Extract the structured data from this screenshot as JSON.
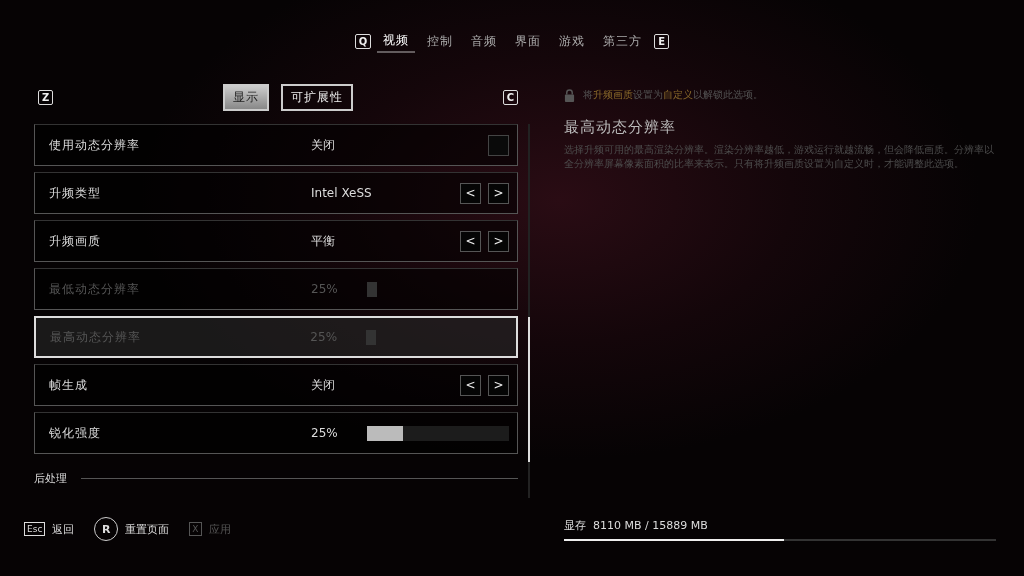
{
  "top_tabs": {
    "left_key": "Q",
    "right_key": "E",
    "tabs": [
      {
        "label": "视频",
        "selected": true
      },
      {
        "label": "控制",
        "selected": false
      },
      {
        "label": "音频",
        "selected": false
      },
      {
        "label": "界面",
        "selected": false
      },
      {
        "label": "游戏",
        "selected": false
      },
      {
        "label": "第三方",
        "selected": false
      }
    ]
  },
  "sub_tabs": {
    "left_key": "Z",
    "right_key": "C",
    "tabs": [
      {
        "label": "显示",
        "selected": true
      },
      {
        "label": "可扩展性",
        "selected": false
      }
    ]
  },
  "settings": [
    {
      "kind": "checkbox",
      "label": "使用动态分辨率",
      "value": "关闭",
      "checked": false,
      "disabled": false,
      "selected": false
    },
    {
      "kind": "selector",
      "label": "升频类型",
      "value": "Intel XeSS",
      "prev": "<",
      "next": ">",
      "disabled": false,
      "selected": false
    },
    {
      "kind": "selector",
      "label": "升频画质",
      "value": "平衡",
      "prev": "<",
      "next": ">",
      "disabled": false,
      "selected": false
    },
    {
      "kind": "slider",
      "label": "最低动态分辨率",
      "value": "25%",
      "level": 0.05,
      "disabled": true,
      "selected": false
    },
    {
      "kind": "slider",
      "label": "最高动态分辨率",
      "value": "25%",
      "level": 0.05,
      "disabled": true,
      "selected": true
    },
    {
      "kind": "selector",
      "label": "帧生成",
      "value": "关闭",
      "prev": "<",
      "next": ">",
      "disabled": false,
      "selected": false
    },
    {
      "kind": "slider",
      "label": "锐化强度",
      "value": "25%",
      "level": 0.25,
      "disabled": false,
      "selected": false
    }
  ],
  "section_heading": "后处理",
  "info": {
    "lock_hint": [
      {
        "text": "将",
        "highlight": false
      },
      {
        "text": "升频画质",
        "highlight": true
      },
      {
        "text": "设置为",
        "highlight": false
      },
      {
        "text": "自定义",
        "highlight": true
      },
      {
        "text": "以解锁此选项。",
        "highlight": false
      }
    ],
    "title": "最高动态分辨率",
    "description": "选择升频可用的最高渲染分辨率。渲染分辨率越低，游戏运行就越流畅，但会降低画质。分辨率以全分辨率屏幕像素面积的比率来表示。只有将升频画质设置为自定义时，才能调整此选项。"
  },
  "footer": {
    "actions": [
      {
        "key": "Esc",
        "label": "返回",
        "kind": "small",
        "disabled": false
      },
      {
        "key": "R",
        "label": "重置页面",
        "kind": "round",
        "disabled": false
      },
      {
        "key": "X",
        "label": "应用",
        "kind": "small",
        "disabled": true
      }
    ],
    "vram": {
      "label": "显存",
      "reading": "8110 MB / 15889 MB",
      "level": 0.51
    }
  }
}
